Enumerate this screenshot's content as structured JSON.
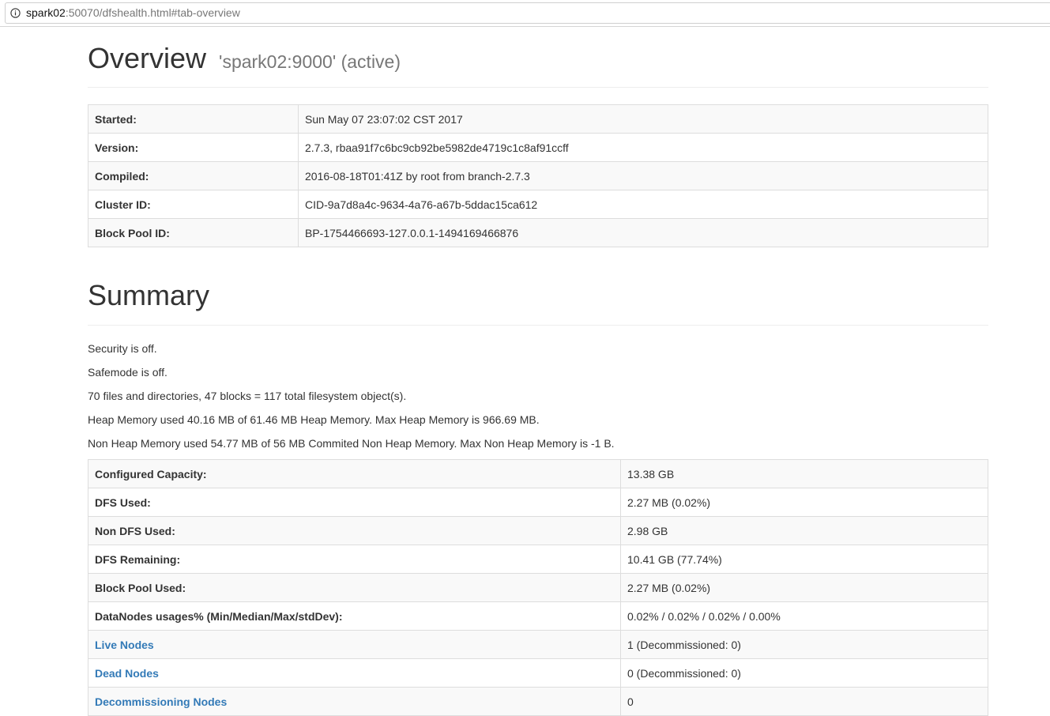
{
  "browser": {
    "url_host": "spark02",
    "url_rest": ":50070/dfshealth.html#tab-overview"
  },
  "overview": {
    "title": "Overview",
    "subtitle": "'spark02:9000' (active)",
    "rows": [
      {
        "key": "Started:",
        "value": "Sun May 07 23:07:02 CST 2017"
      },
      {
        "key": "Version:",
        "value": "2.7.3, rbaa91f7c6bc9cb92be5982de4719c1c8af91ccff"
      },
      {
        "key": "Compiled:",
        "value": "2016-08-18T01:41Z by root from branch-2.7.3"
      },
      {
        "key": "Cluster ID:",
        "value": "CID-9a7d8a4c-9634-4a76-a67b-5ddac15ca612"
      },
      {
        "key": "Block Pool ID:",
        "value": "BP-1754466693-127.0.0.1-1494169466876"
      }
    ]
  },
  "summary": {
    "title": "Summary",
    "lines": [
      "Security is off.",
      "Safemode is off.",
      "70 files and directories, 47 blocks = 117 total filesystem object(s).",
      "Heap Memory used 40.16 MB of 61.46 MB Heap Memory. Max Heap Memory is 966.69 MB.",
      "Non Heap Memory used 54.77 MB of 56 MB Commited Non Heap Memory. Max Non Heap Memory is -1 B."
    ],
    "rows": [
      {
        "key": "Configured Capacity:",
        "value": "13.38 GB"
      },
      {
        "key": "DFS Used:",
        "value": "2.27 MB (0.02%)"
      },
      {
        "key": "Non DFS Used:",
        "value": "2.98 GB"
      },
      {
        "key": "DFS Remaining:",
        "value": "10.41 GB (77.74%)"
      },
      {
        "key": "Block Pool Used:",
        "value": "2.27 MB (0.02%)"
      },
      {
        "key": "DataNodes usages% (Min/Median/Max/stdDev):",
        "value": "0.02% / 0.02% / 0.02% / 0.00%"
      },
      {
        "key": "Live Nodes",
        "value": "1 (Decommissioned: 0)"
      },
      {
        "key": "Dead Nodes",
        "value": "0 (Decommissioned: 0)"
      },
      {
        "key": "Decommissioning Nodes",
        "value": "0"
      }
    ]
  },
  "colors": {
    "link": "#337ab7",
    "text": "#333333",
    "muted": "#777777",
    "border": "#dddddd",
    "stripe": "#f9f9f9"
  },
  "icons": {
    "address_bar": "info-circle-icon"
  }
}
